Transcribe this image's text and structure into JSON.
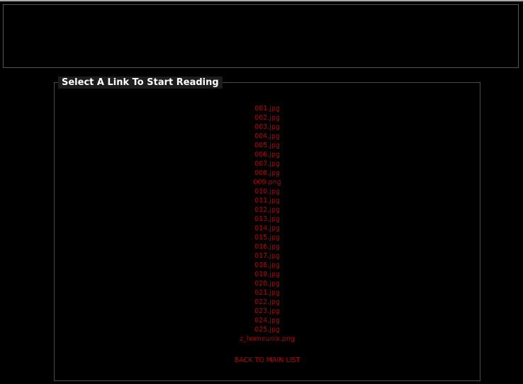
{
  "panel": {
    "title": "Select A Link To Start Reading"
  },
  "files": [
    "001.jpg",
    "002.jpg",
    "003.jpg",
    "004.jpg",
    "005.jpg",
    "006.jpg",
    "007.jpg",
    "008.jpg",
    "009.png",
    "010.jpg",
    "011.jpg",
    "012.jpg",
    "013.jpg",
    "014.jpg",
    "015.jpg",
    "016.jpg",
    "017.jpg",
    "018.jpg",
    "019.jpg",
    "020.jpg",
    "021.jpg",
    "022.jpg",
    "023.jpg",
    "024.jpg",
    "025.jpg",
    "z_homeunix.png"
  ],
  "back_link": "BACK TO MAIN LIST",
  "colors": {
    "background": "#000000",
    "link": "#b30000",
    "legend_bg": "#1c1c1c",
    "legend_text": "#ffffff",
    "border": "#4a4a4a"
  }
}
